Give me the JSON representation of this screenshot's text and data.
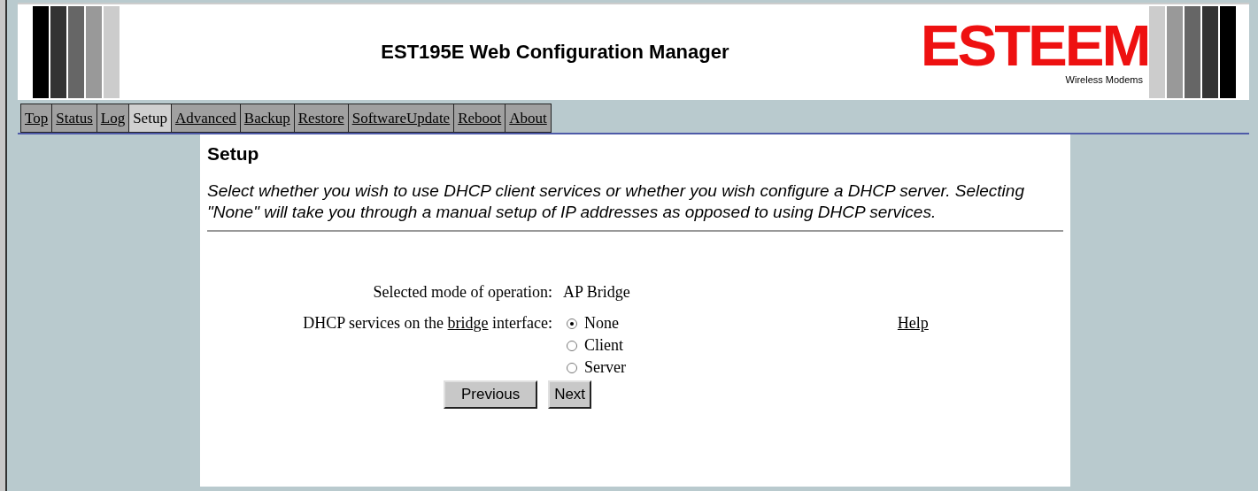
{
  "header": {
    "title": "EST195E Web Configuration Manager",
    "logo": {
      "name": "ESTEEM",
      "tagline": "Wireless Modems"
    }
  },
  "tabs": [
    {
      "label": "Top",
      "selected": false
    },
    {
      "label": "Status",
      "selected": false
    },
    {
      "label": "Log",
      "selected": false
    },
    {
      "label": "Setup",
      "selected": true
    },
    {
      "label": "Advanced",
      "selected": false
    },
    {
      "label": "Backup",
      "selected": false
    },
    {
      "label": "Restore",
      "selected": false
    },
    {
      "label": "SoftwareUpdate",
      "selected": false
    },
    {
      "label": "Reboot",
      "selected": false
    },
    {
      "label": "About",
      "selected": false
    }
  ],
  "content": {
    "heading": "Setup",
    "description": "Select whether you wish to use DHCP client services or whether you wish configure a DHCP server. Selecting \"None\" will take you through a manual setup of IP addresses as opposed to using DHCP services.",
    "mode_label": "Selected mode of operation:",
    "mode_value": "AP Bridge",
    "dhcp_label_before": "DHCP services on the",
    "dhcp_label_link": "bridge",
    "dhcp_label_after": "interface:",
    "dhcp_options": [
      {
        "label": "None",
        "selected": true
      },
      {
        "label": "Client",
        "selected": false
      },
      {
        "label": "Server",
        "selected": false
      }
    ],
    "help_link": "Help",
    "buttons": [
      "Previous",
      "Next"
    ]
  }
}
